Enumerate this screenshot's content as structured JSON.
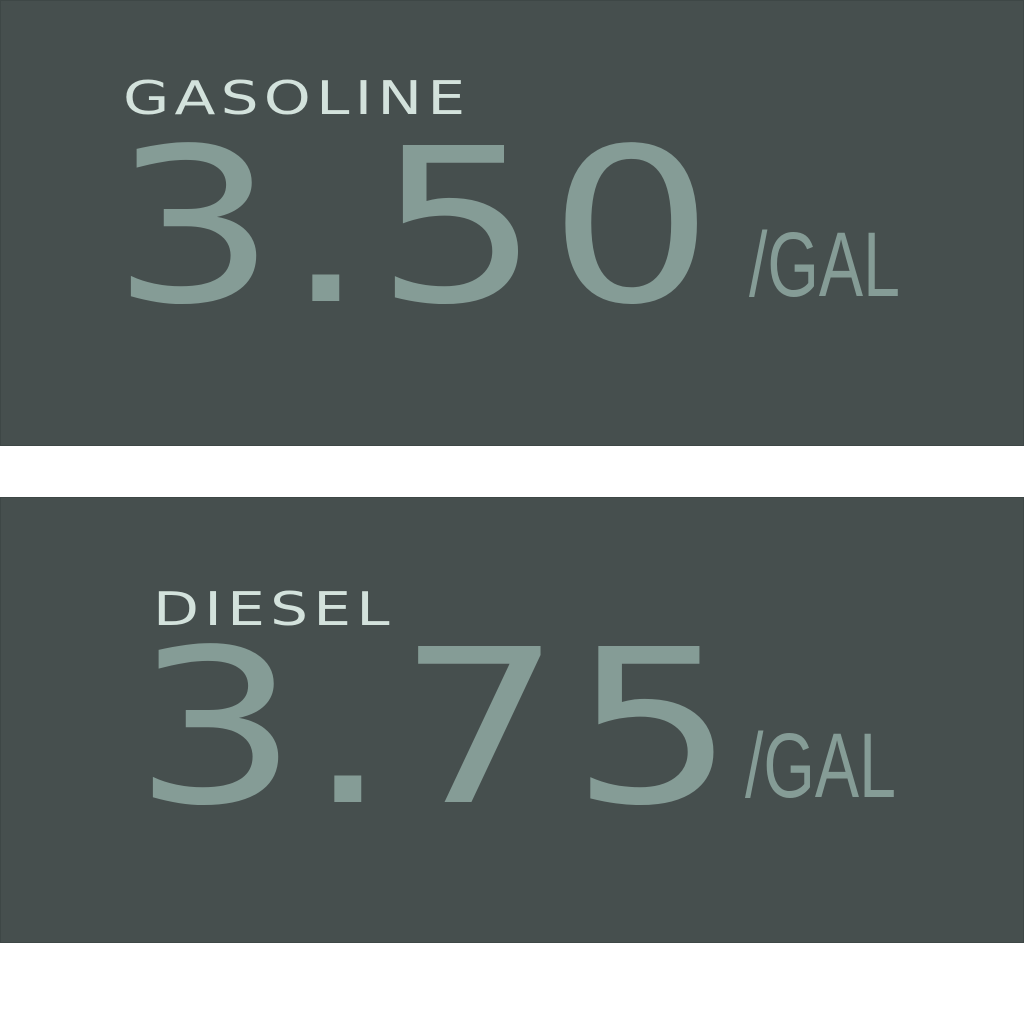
{
  "colors": {
    "panel_background": "#464f4e",
    "label_text": "#d3e2dc",
    "price_text": "#859c96",
    "page_background": "#ffffff"
  },
  "prices": [
    {
      "fuel": "GASOLINE",
      "price": "3.50",
      "unit": "/GAL"
    },
    {
      "fuel": "DIESEL",
      "price": "3.75",
      "unit": "/GAL"
    }
  ]
}
